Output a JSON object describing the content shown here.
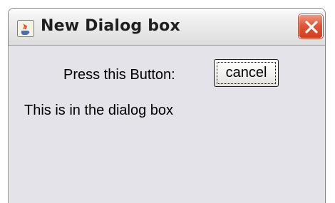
{
  "window": {
    "title": "New Dialog box",
    "app_icon": "java-cup-icon",
    "close_icon": "close-x-icon",
    "accent_color": "#d84a2b"
  },
  "content": {
    "prompt_label": "Press this Button:",
    "cancel_label": "cancel",
    "message": "This is in the dialog box"
  }
}
